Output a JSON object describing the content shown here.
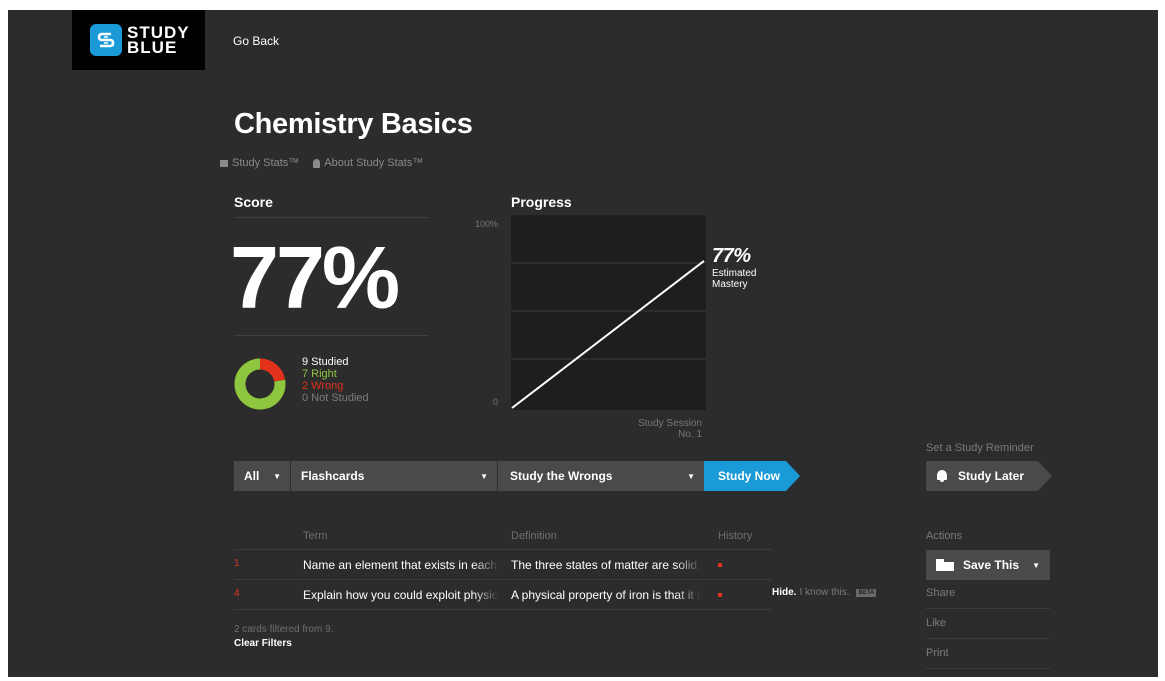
{
  "header": {
    "logo_line1": "STUDY",
    "logo_line2": "BLUE",
    "go_back": "Go Back"
  },
  "deck": {
    "title": "Chemistry Basics",
    "study_stats_link": "Study Stats™",
    "about_stats_link": "About Study Stats™"
  },
  "score": {
    "heading": "Score",
    "value": "77%",
    "studied": "9 Studied",
    "right": "7 Right",
    "wrong": "2 Wrong",
    "not_studied": "0 Not Studied",
    "right_count": 7,
    "wrong_count": 2,
    "colors": {
      "right": "#8ec63f",
      "wrong": "#e2321c"
    }
  },
  "progress": {
    "heading": "Progress",
    "y_top": "100%",
    "y_bottom": "0",
    "mastery_value": "77%",
    "mastery_label1": "Estimated",
    "mastery_label2": "Mastery",
    "x_caption1": "Study Session",
    "x_caption2": "No. 1",
    "start_value": 0,
    "end_value": 77
  },
  "filters": {
    "all": "All",
    "cards": "Flashcards",
    "wrongs": "Study the Wrongs",
    "study_now": "Study Now"
  },
  "reminder": {
    "label": "Set a Study Reminder",
    "button": "Study Later"
  },
  "table": {
    "headers": {
      "term": "Term",
      "definition": "Definition",
      "history": "History"
    },
    "rows": [
      {
        "num": "1",
        "term": "Name an element that exists in each",
        "definition": "The three states of matter are solid,"
      },
      {
        "num": "4",
        "term": "Explain how you could exploit physical",
        "definition": "A physical property of iron is that it is"
      }
    ],
    "hide": "Hide.",
    "know": "I know this.",
    "beta": "BETA",
    "filtered_note": "2 cards filtered from 9.",
    "clear_filters": "Clear Filters"
  },
  "actions": {
    "label": "Actions",
    "save": "Save This",
    "share": "Share",
    "like": "Like",
    "print": "Print"
  },
  "accent_color": "#1a9ad6"
}
